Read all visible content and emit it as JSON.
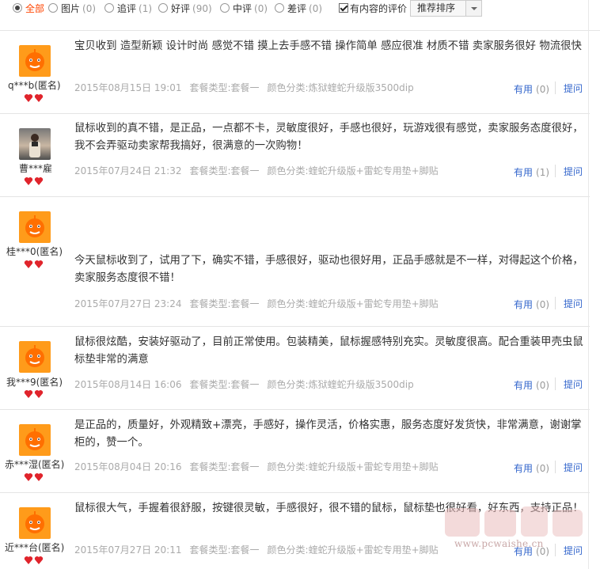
{
  "filters": [
    {
      "label": "全部",
      "count": "",
      "selected": true
    },
    {
      "label": "图片",
      "count": "(0)",
      "selected": false
    },
    {
      "label": "追评",
      "count": "(1)",
      "selected": false
    },
    {
      "label": "好评",
      "count": "(90)",
      "selected": false
    },
    {
      "label": "中评",
      "count": "(0)",
      "selected": false
    },
    {
      "label": "差评",
      "count": "(0)",
      "selected": false
    }
  ],
  "content_only_label": "有内容的评价",
  "content_only_checked": true,
  "sort_label": "推荐排序",
  "reviews": [
    {
      "user": "q***b(匿名)",
      "text": "宝贝收到 造型新颖 设计时尚 感觉不错 摸上去手感不错 操作简单 感应很准 材质不错 卖家服务很好 物流很快",
      "date": "2015年08月15日 19:01",
      "package": "套餐类型:套餐一",
      "color": "颜色分类:炼狱蝰蛇升级版3500dip",
      "useful_label": "有用",
      "useful_count": "(0)",
      "ask_label": "提问",
      "avatar": "orange"
    },
    {
      "user": "曹***雇",
      "text": "鼠标收到的真不错，是正品，一点都不卡，灵敏度很好，手感也很好，玩游戏很有感觉，卖家服务态度很好，我不会弄驱动卖家帮我搞好，很满意的一次购物！",
      "date": "2015年07月24日 21:32",
      "package": "套餐类型:套餐一",
      "color": "颜色分类:蝰蛇升级版+雷蛇专用垫+脚贴",
      "useful_label": "有用",
      "useful_count": "(1)",
      "ask_label": "提问",
      "avatar": "photo"
    },
    {
      "user": "桂***0(匿名)",
      "text": "今天鼠标收到了，试用了下，确实不错，手感很好，驱动也很好用，正品手感就是不一样，对得起这个价格，卖家服务态度很不错！",
      "date": "2015年07月27日 23:24",
      "package": "套餐类型:套餐一",
      "color": "颜色分类:蝰蛇升级版+雷蛇专用垫+脚贴",
      "useful_label": "有用",
      "useful_count": "(0)",
      "ask_label": "提问",
      "avatar": "orange"
    },
    {
      "user": "我***9(匿名)",
      "text": "鼠标很炫酷，安装好驱动了，目前正常使用。包装精美，鼠标握感特别充实。灵敏度很高。配合重装甲壳虫鼠标垫非常的满意",
      "date": "2015年08月14日 16:06",
      "package": "套餐类型:套餐一",
      "color": "颜色分类:炼狱蝰蛇升级版3500dip",
      "useful_label": "有用",
      "useful_count": "(0)",
      "ask_label": "提问",
      "avatar": "orange"
    },
    {
      "user": "赤***湿(匿名)",
      "text": "是正品的，质量好，外观精致+漂亮，手感好，操作灵活，价格实惠，服务态度好发货快，非常满意，谢谢掌柜的，赞一个。",
      "date": "2015年08月04日 20:16",
      "package": "套餐类型:套餐一",
      "color": "颜色分类:蝰蛇升级版+雷蛇专用垫+脚贴",
      "useful_label": "有用",
      "useful_count": "(0)",
      "ask_label": "提问",
      "avatar": "orange"
    },
    {
      "user": "近***台(匿名)",
      "text": "鼠标很大气，手握着很舒服，按键很灵敏，手感很好，很不错的鼠标，鼠标垫也很好看，好东西，支持正品！",
      "date": "2015年07月27日 20:11",
      "package": "套餐类型:套餐一",
      "color": "颜色分类:蝰蛇升级版+雷蛇专用垫+脚贴",
      "useful_label": "有用",
      "useful_count": "(0)",
      "ask_label": "提问",
      "avatar": "orange"
    }
  ],
  "watermark": {
    "url": "www.pcwaishe.cn"
  },
  "colors": {
    "link": "#3366cc",
    "active": "#ff4400",
    "avatar": "#ff9b1a",
    "heart": "#e0242c"
  }
}
